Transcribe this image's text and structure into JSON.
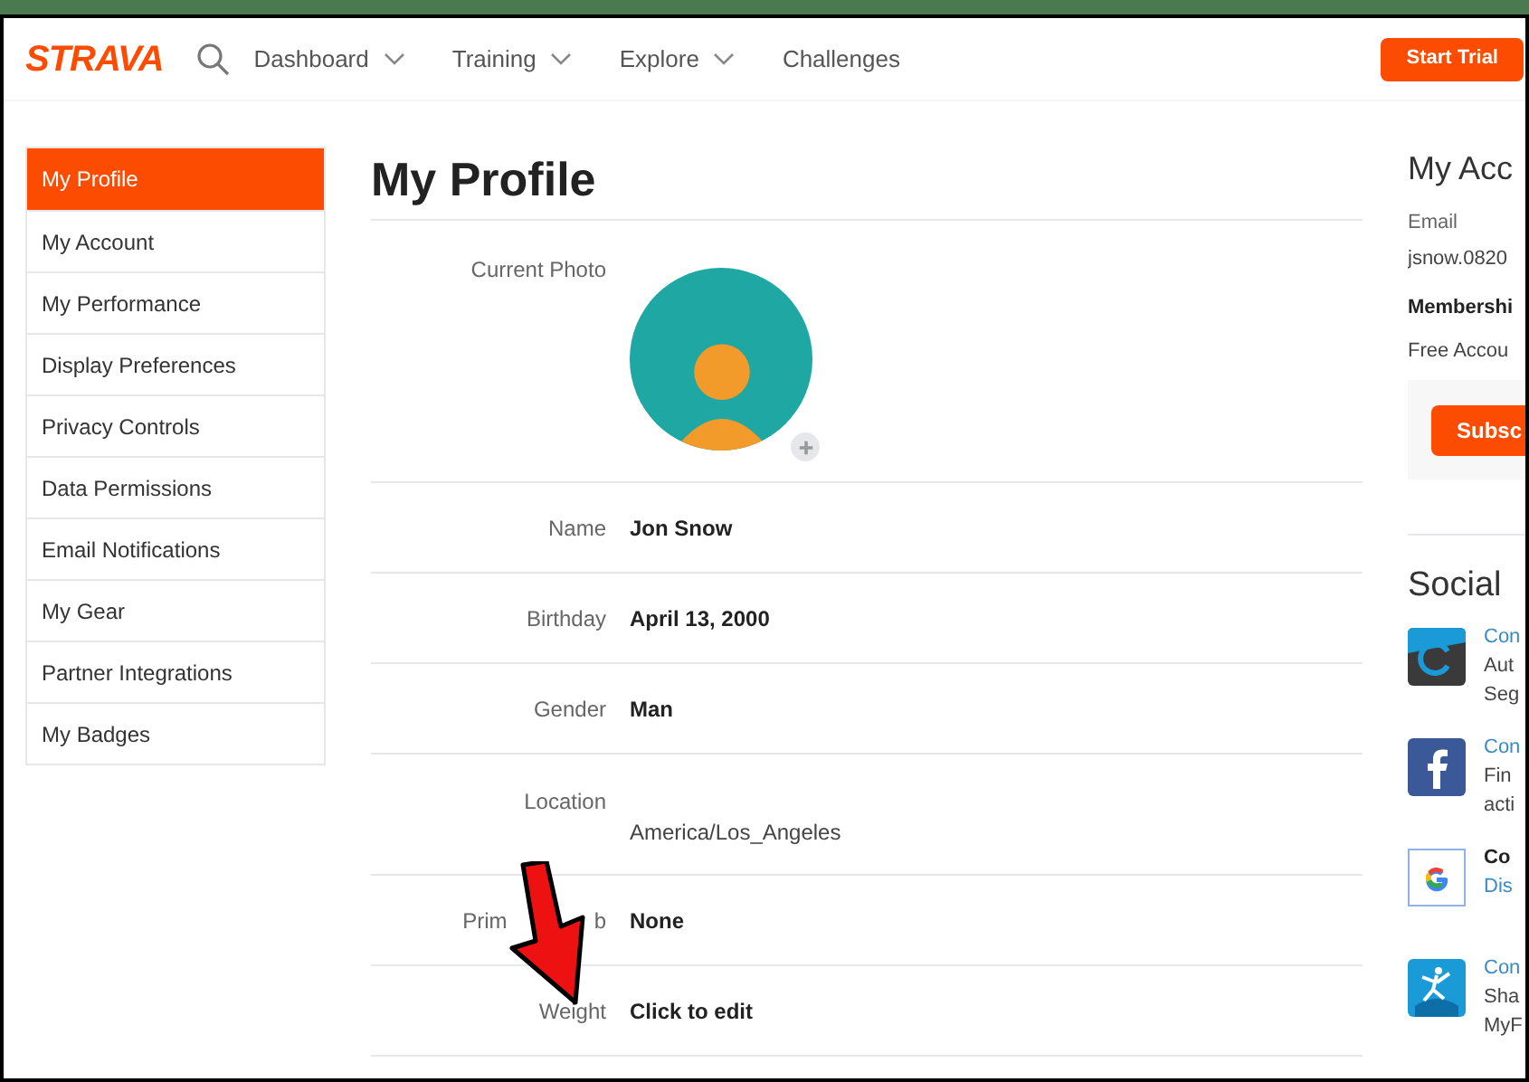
{
  "nav": {
    "logo": "STRAVA",
    "items": [
      {
        "label": "Dashboard",
        "dropdown": true
      },
      {
        "label": "Training",
        "dropdown": true
      },
      {
        "label": "Explore",
        "dropdown": true
      },
      {
        "label": "Challenges",
        "dropdown": false
      }
    ],
    "cta": "Start Trial"
  },
  "sidebar": {
    "items": [
      {
        "label": "My Profile",
        "selected": true
      },
      {
        "label": "My Account",
        "selected": false
      },
      {
        "label": "My Performance",
        "selected": false
      },
      {
        "label": "Display Preferences",
        "selected": false
      },
      {
        "label": "Privacy Controls",
        "selected": false
      },
      {
        "label": "Data Permissions",
        "selected": false
      },
      {
        "label": "Email Notifications",
        "selected": false
      },
      {
        "label": "My Gear",
        "selected": false
      },
      {
        "label": "Partner Integrations",
        "selected": false
      },
      {
        "label": "My Badges",
        "selected": false
      }
    ]
  },
  "profile": {
    "title": "My Profile",
    "rows": [
      {
        "kind": "photo",
        "label": "Current Photo"
      },
      {
        "kind": "field",
        "label": "Name",
        "value": "Jon Snow"
      },
      {
        "kind": "field",
        "label": "Birthday",
        "value": "April 13, 2000"
      },
      {
        "kind": "field",
        "label": "Gender",
        "value": "Man"
      },
      {
        "kind": "stacked",
        "label": "Location",
        "value": "America/Los_Angeles"
      },
      {
        "kind": "covered",
        "label": "Prim",
        "label_end": "b",
        "value": "None"
      },
      {
        "kind": "field",
        "label": "Weight",
        "value": "Click to edit"
      }
    ]
  },
  "account": {
    "title": "My Acc",
    "email_label": "Email",
    "email": "jsnow.0820",
    "membership_label": "Membershi",
    "membership": "Free Accou",
    "button": "Subsc"
  },
  "social": {
    "title": "Social",
    "items": [
      {
        "kind": "garmin",
        "link": "Con",
        "lines": [
          "Aut",
          "Seg"
        ]
      },
      {
        "kind": "facebook",
        "link": "Con",
        "lines": [
          "Fin",
          "acti"
        ]
      },
      {
        "kind": "google",
        "heading": "Co",
        "link": "Dis"
      },
      {
        "kind": "runner",
        "link": "Con",
        "lines": [
          "Sha",
          "MyF"
        ]
      }
    ]
  }
}
